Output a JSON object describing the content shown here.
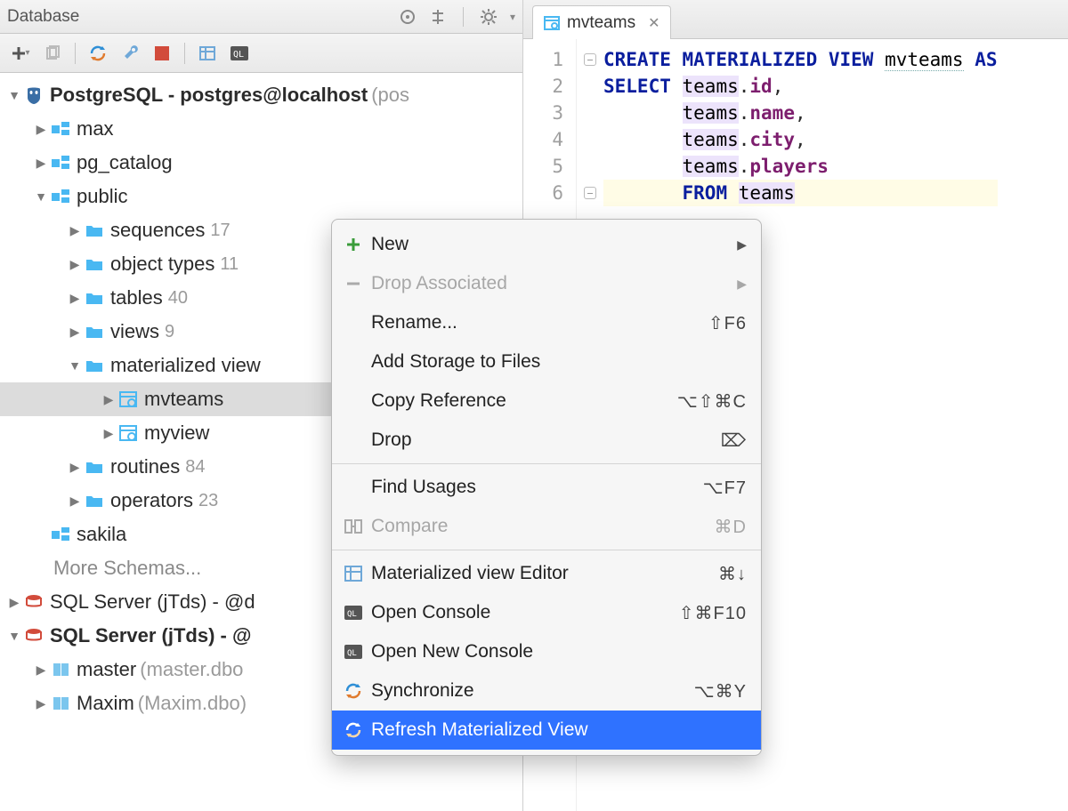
{
  "panel": {
    "title": "Database"
  },
  "tree": {
    "root": {
      "label": "PostgreSQL - postgres@localhost",
      "suffix": "(pos"
    },
    "schemas": {
      "max": "max",
      "pg_catalog": "pg_catalog",
      "public": "public",
      "sakila": "sakila",
      "more": "More Schemas..."
    },
    "public_children": {
      "sequences": {
        "label": "sequences",
        "count": "17"
      },
      "object_types": {
        "label": "object types",
        "count": "11"
      },
      "tables": {
        "label": "tables",
        "count": "40"
      },
      "views": {
        "label": "views",
        "count": "9"
      },
      "materialized_views": {
        "label": "materialized view"
      },
      "routines": {
        "label": "routines",
        "count": "84"
      },
      "operators": {
        "label": "operators",
        "count": "23"
      }
    },
    "matviews": {
      "mvteams": "mvteams",
      "myview": "myview"
    },
    "servers": {
      "sql1": {
        "label": "SQL Server (jTds) - @d"
      },
      "sql2": {
        "label": "SQL Server (jTds) - @"
      },
      "master": {
        "label": "master",
        "suffix": "(master.dbo"
      },
      "maxim": {
        "label": "Maxim",
        "suffix": "(Maxim.dbo)"
      }
    }
  },
  "tab": {
    "label": "mvteams"
  },
  "code": {
    "l1a": "CREATE MATERIALIZED VIEW ",
    "l1b": "mvteams",
    "l1c": " AS",
    "l2a": "SELECT ",
    "l2b": "teams",
    "l2c": ".",
    "l2d": "id",
    "l2e": ",",
    "l3a": "       ",
    "l3b": "teams",
    "l3c": ".",
    "l3d": "name",
    "l3e": ",",
    "l4b": "teams",
    "l4d": "city",
    "l5b": "teams",
    "l5d": "players",
    "l6a": "       ",
    "l6b": "FROM ",
    "l6c": "teams"
  },
  "gutter": [
    "1",
    "2",
    "3",
    "4",
    "5",
    "6"
  ],
  "menu": {
    "new": "New",
    "drop_assoc": "Drop Associated",
    "rename": "Rename...",
    "rename_sc": "⇧F6",
    "add_storage": "Add Storage to Files",
    "copy_ref": "Copy Reference",
    "copy_ref_sc": "⌥⇧⌘C",
    "drop": "Drop",
    "drop_sc": "⌦",
    "find_usages": "Find Usages",
    "find_usages_sc": "⌥F7",
    "compare": "Compare",
    "compare_sc": "⌘D",
    "mview_editor": "Materialized view Editor",
    "mview_editor_sc": "⌘↓",
    "open_console": "Open Console",
    "open_console_sc": "⇧⌘F10",
    "open_new_console": "Open New Console",
    "synchronize": "Synchronize",
    "synchronize_sc": "⌥⌘Y",
    "refresh_mv": "Refresh Materialized View"
  }
}
